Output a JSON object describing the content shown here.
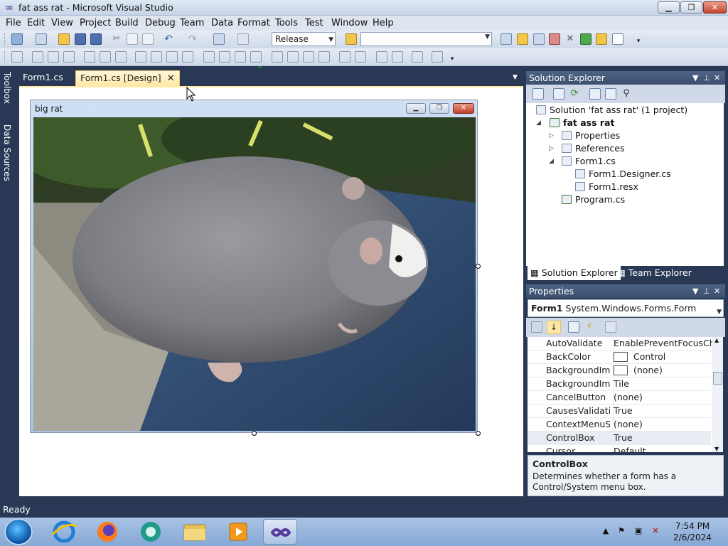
{
  "window": {
    "title": "fat ass rat - Microsoft Visual Studio",
    "app_icon": "infinity-icon",
    "minimize_label": "▁",
    "maximize_label": "❐",
    "close_label": "✕"
  },
  "menu": {
    "items": [
      "File",
      "Edit",
      "View",
      "Project",
      "Build",
      "Debug",
      "Team",
      "Data",
      "Format",
      "Tools",
      "Test",
      "Window",
      "Help"
    ]
  },
  "toolbar": {
    "configuration": "Release",
    "platform": "",
    "start_icon": "play-icon"
  },
  "side_tabs": {
    "toolbox": "Toolbox",
    "data_sources": "Data Sources"
  },
  "doc_tabs": {
    "tabs": [
      "Form1.cs",
      "Form1.cs [Design]"
    ],
    "active": "Form1.cs [Design]",
    "close_glyph": "✕"
  },
  "designer": {
    "form_title": "big rat",
    "picture": "rat-photo"
  },
  "solution_explorer": {
    "header": "Solution Explorer",
    "tree": {
      "solution": "Solution 'fat ass rat' (1 project)",
      "project": "fat ass rat",
      "properties": "Properties",
      "references": "References",
      "form1": "Form1.cs",
      "form1_designer": "Form1.Designer.cs",
      "form1_resx": "Form1.resx",
      "program": "Program.cs"
    },
    "tabs": [
      "Solution Explorer",
      "Team Explorer"
    ]
  },
  "properties": {
    "header": "Properties",
    "object_name": "Form1",
    "object_type": "System.Windows.Forms.Form",
    "rows": [
      {
        "name": "AutoValidate",
        "value": "EnablePreventFocusChange"
      },
      {
        "name": "BackColor",
        "value": "Control"
      },
      {
        "name": "BackgroundImage",
        "value": "(none)"
      },
      {
        "name": "BackgroundImageLayout",
        "value": "Tile"
      },
      {
        "name": "CancelButton",
        "value": "(none)"
      },
      {
        "name": "CausesValidation",
        "value": "True"
      },
      {
        "name": "ContextMenuStrip",
        "value": "(none)"
      },
      {
        "name": "ControlBox",
        "value": "True"
      },
      {
        "name": "Cursor",
        "value": "Default"
      }
    ],
    "desc_title": "ControlBox",
    "desc_text": "Determines whether a form has a Control/System menu box."
  },
  "status": {
    "text": "Ready"
  },
  "taskbar": {
    "time": "7:54 PM",
    "date": "2/6/2024"
  },
  "colors": {
    "chrome": "#293955",
    "active_tab": "#ffe8a6",
    "panel_header": "#4f6384"
  }
}
